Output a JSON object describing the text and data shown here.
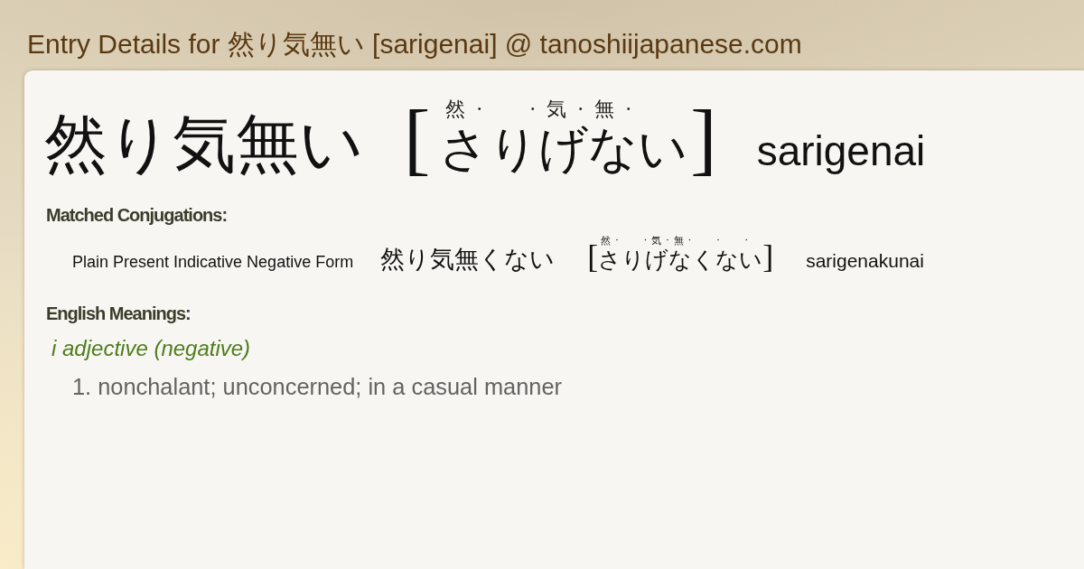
{
  "page": {
    "title": "Entry Details for 然り気無い [sarigenai] @ tanoshiijapanese.com"
  },
  "entry": {
    "headword": "然り気無い",
    "reading": {
      "open": "[",
      "annotation": "然·  ·気·無·",
      "kana": "さりげない",
      "close": "]"
    },
    "romaji": "sarigenai"
  },
  "conjugations": {
    "heading": "Matched Conjugations:",
    "items": [
      {
        "form": "Plain Present Indicative Negative Form",
        "word": "然り気無くない",
        "reading": {
          "open": "[",
          "annotation": "然·  ·気·無·  ·  ·",
          "kana": "さりげなくない",
          "close": "]"
        },
        "romaji": "sarigenakunai"
      }
    ]
  },
  "meanings": {
    "heading": "English Meanings:",
    "groups": [
      {
        "part_of_speech": "i adjective (negative)",
        "senses": [
          {
            "number": "1.",
            "text": "nonchalant; unconcerned; in a casual manner"
          }
        ]
      }
    ]
  }
}
